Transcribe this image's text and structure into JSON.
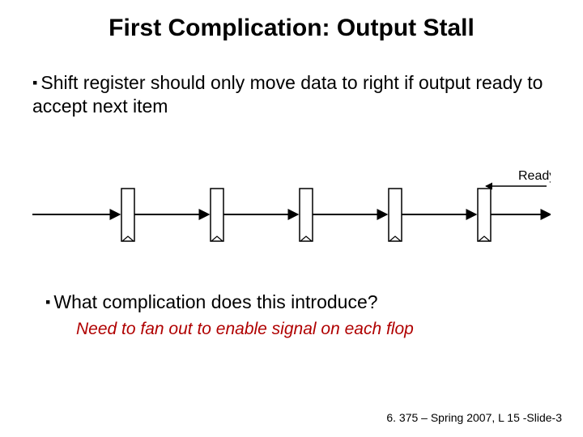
{
  "title": "First Complication: Output Stall",
  "bullet1": "Shift register should only move data to right if output ready to accept next item",
  "ready_label": "Ready",
  "bullet2": "What complication does this introduce?",
  "answer": "Need to fan out to enable signal on each flop",
  "footer": "6. 375 – Spring 2007, L 15 -Slide-3"
}
